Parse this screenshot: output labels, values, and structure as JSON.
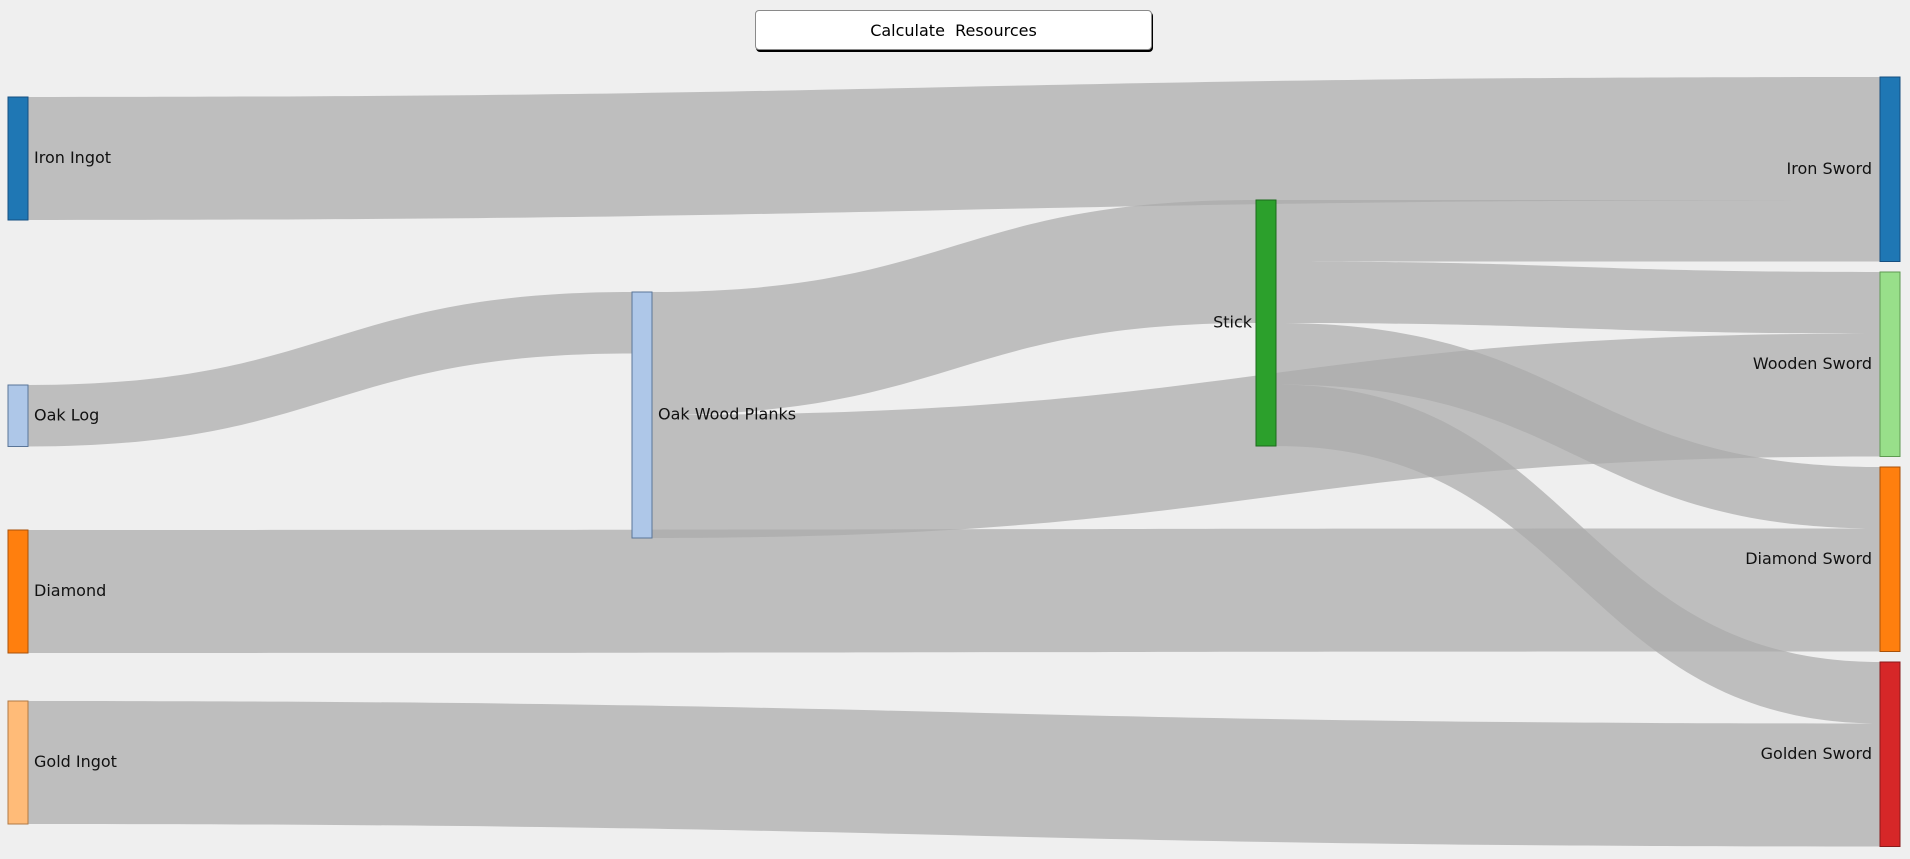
{
  "button": {
    "label": "Calculate  Resources"
  },
  "chart_data": {
    "type": "sankey",
    "link_color": "#a9a9a9",
    "nodes": [
      {
        "id": "iron_ingot",
        "label": "Iron Ingot",
        "color": "#1f77b4",
        "stroke": "#164f80"
      },
      {
        "id": "oak_log",
        "label": "Oak Log",
        "color": "#aec7e8",
        "stroke": "#5a7598"
      },
      {
        "id": "diamond",
        "label": "Diamond",
        "color": "#ff7f0e",
        "stroke": "#a8520a"
      },
      {
        "id": "gold_ingot",
        "label": "Gold Ingot",
        "color": "#ffbb78",
        "stroke": "#b07a44"
      },
      {
        "id": "oak_wood_planks",
        "label": "Oak Wood Planks",
        "color": "#aec7e8",
        "stroke": "#5a7598"
      },
      {
        "id": "stick",
        "label": "Stick",
        "color": "#2ca02c",
        "stroke": "#1c6a1c"
      },
      {
        "id": "iron_sword",
        "label": "Iron Sword",
        "color": "#1f77b4",
        "stroke": "#164f80"
      },
      {
        "id": "wooden_sword",
        "label": "Wooden Sword",
        "color": "#98df8a",
        "stroke": "#5e9a52"
      },
      {
        "id": "diamond_sword",
        "label": "Diamond Sword",
        "color": "#ff7f0e",
        "stroke": "#a8520a"
      },
      {
        "id": "golden_sword",
        "label": "Golden Sword",
        "color": "#d62728",
        "stroke": "#8a1a1a"
      }
    ],
    "links": [
      {
        "source": "iron_ingot",
        "target": "iron_sword",
        "value": 2
      },
      {
        "source": "oak_log",
        "target": "oak_wood_planks",
        "value": 1
      },
      {
        "source": "oak_wood_planks",
        "target": "stick",
        "value": 2
      },
      {
        "source": "oak_wood_planks",
        "target": "wooden_sword",
        "value": 2
      },
      {
        "source": "stick",
        "target": "iron_sword",
        "value": 1
      },
      {
        "source": "stick",
        "target": "wooden_sword",
        "value": 1
      },
      {
        "source": "stick",
        "target": "diamond_sword",
        "value": 1
      },
      {
        "source": "stick",
        "target": "golden_sword",
        "value": 1
      },
      {
        "source": "diamond",
        "target": "diamond_sword",
        "value": 2
      },
      {
        "source": "gold_ingot",
        "target": "golden_sword",
        "value": 2
      }
    ]
  }
}
